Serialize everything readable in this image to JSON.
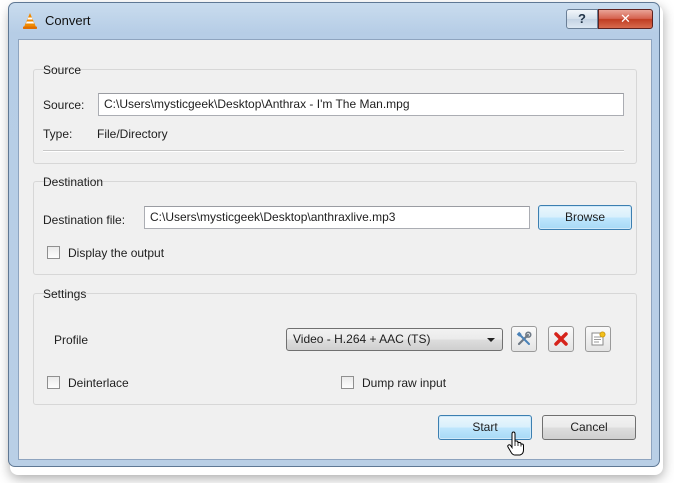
{
  "window": {
    "title": "Convert",
    "help_label": "?",
    "close_label": "✕"
  },
  "source": {
    "group_title": "Source",
    "source_label": "Source:",
    "source_value": "C:\\Users\\mysticgeek\\Desktop\\Anthrax - I'm The Man.mpg",
    "type_label": "Type:",
    "type_value": "File/Directory"
  },
  "destination": {
    "group_title": "Destination",
    "file_label": "Destination file:",
    "file_value": "C:\\Users\\mysticgeek\\Desktop\\anthraxlive.mp3",
    "browse_label": "Browse",
    "display_output_label": "Display the output",
    "display_output_checked": false
  },
  "settings": {
    "group_title": "Settings",
    "profile_label": "Profile",
    "profile_selected": "Video - H.264 + AAC (TS)",
    "deinterlace_label": "Deinterlace",
    "deinterlace_checked": false,
    "dump_raw_label": "Dump raw input",
    "dump_raw_checked": false,
    "tools": [
      "edit-profile-icon",
      "delete-profile-icon",
      "new-profile-icon"
    ]
  },
  "buttons": {
    "start_label": "Start",
    "cancel_label": "Cancel"
  },
  "colors": {
    "accent": "#3c7fb1",
    "delete_red": "#d6231b",
    "vlc_orange": "#f08a00"
  }
}
